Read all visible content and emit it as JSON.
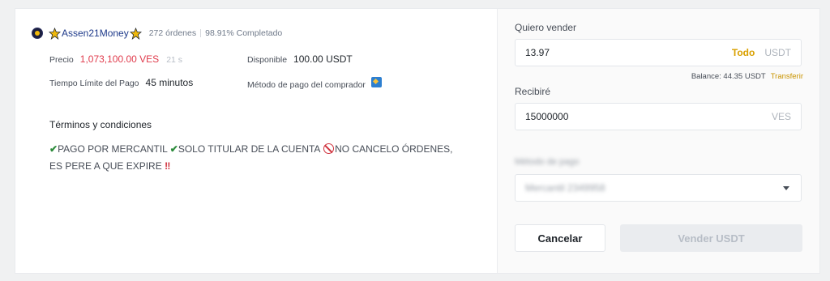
{
  "advertiser": {
    "name": "Assen21Money",
    "orders": "272 órdenes",
    "completion": "98.91% Completado"
  },
  "details": {
    "price_label": "Precio",
    "price_value": "1,073,100.00 VES",
    "timer": "21 s",
    "available_label": "Disponible",
    "available_value": "100.00 USDT",
    "time_limit_label": "Tiempo Límite del Pago",
    "time_limit_value": "45 minutos",
    "payment_method_label": "Método de pago del comprador"
  },
  "terms": {
    "title": "Términos y condiciones",
    "part1": "PAGO POR MERCANTIL",
    "part2": "SOLO TITULAR DE LA CUENTA",
    "part3": "NO CANCELO ÓRDENES, ES PERE A QUE EXPIRE",
    "bang": "‼"
  },
  "sell_form": {
    "sell_label": "Quiero vender",
    "sell_amount": "13.97",
    "all_link": "Todo",
    "sell_unit": "USDT",
    "balance_text": "Balance: 44.35 USDT",
    "transfer_link": "Transferir",
    "receive_label": "Recibiré",
    "receive_amount": "15000000",
    "receive_unit": "VES",
    "payment_label_blurred": "Método de pago",
    "payment_value_blurred": "Mercantil 2349958",
    "cancel_button": "Cancelar",
    "sell_button": "Vender USDT"
  },
  "colors": {
    "price": "#e03b4c",
    "accent_link": "#d9a000",
    "check": "#2d8c3c",
    "prohibited": "#d0323d"
  },
  "icons": {
    "avatar": "avatar-icon",
    "merchant_badge": "merchant-badge-icon",
    "payment_method": "bank-transfer-icon",
    "check": "check-mark-icon",
    "prohibited": "prohibited-icon",
    "dropdown": "chevron-down-icon"
  }
}
